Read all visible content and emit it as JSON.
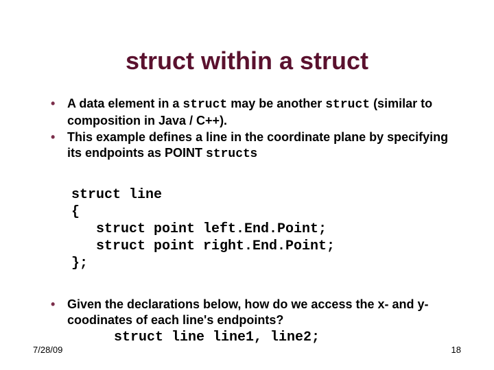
{
  "title": "struct within a struct",
  "bullets": {
    "b1_pre": "A data element in a ",
    "b1_mono1": "struct",
    "b1_mid": " may be another ",
    "b1_mono2": "struct",
    "b1_tail": " (similar to composition in Java / C++).",
    "b2_pre": "This example defines a line in the coordinate plane by specifying its endpoints as POINT ",
    "b2_mono": "struct",
    "b2_suffix": "s",
    "b3_pre": "Given the declarations below, how do we access the x- and y-coodinates of each line's endpoints?",
    "b3_code": "struct line line1, line2;"
  },
  "code": "struct line\n{\n   struct point left.End.Point;\n   struct point right.End.Point;\n};",
  "footer": {
    "date": "7/28/09",
    "page": "18"
  }
}
